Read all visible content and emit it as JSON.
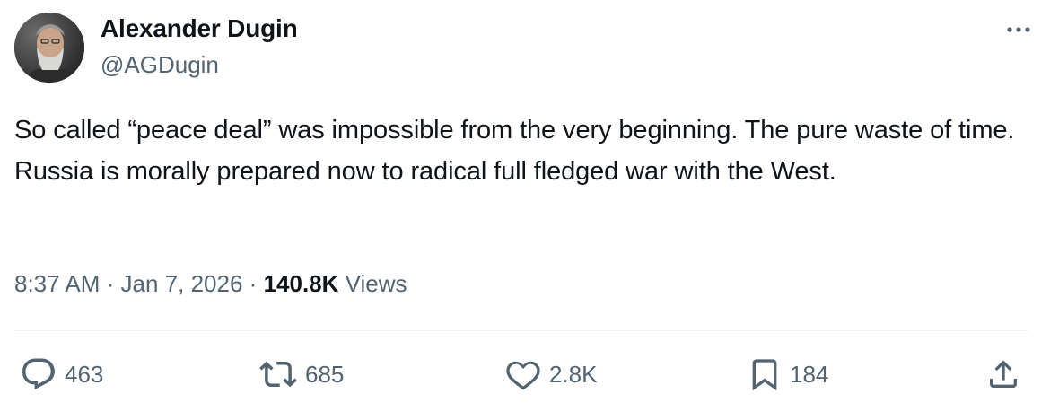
{
  "author": {
    "display_name": "Alexander Dugin",
    "handle": "@AGDugin"
  },
  "tweet": {
    "text": "So called “peace deal” was impossible from the very beginning. The pure waste of time. Russia is morally prepared now to radical full fledged war with the West.",
    "time": "8:37 AM",
    "separator": "·",
    "date": "Jan 7, 2026",
    "views_count": "140.8K",
    "views_label": "Views"
  },
  "actions": {
    "replies": "463",
    "reposts": "685",
    "likes": "2.8K",
    "bookmarks": "184"
  },
  "icons": {
    "more": "more-dots-icon",
    "reply": "reply-bubble-icon",
    "repost": "repost-arrows-icon",
    "like": "heart-icon",
    "bookmark": "bookmark-icon",
    "share": "share-icon"
  },
  "colors": {
    "text_primary": "#0f1419",
    "text_secondary": "#536471",
    "divider": "#eff3f4"
  }
}
